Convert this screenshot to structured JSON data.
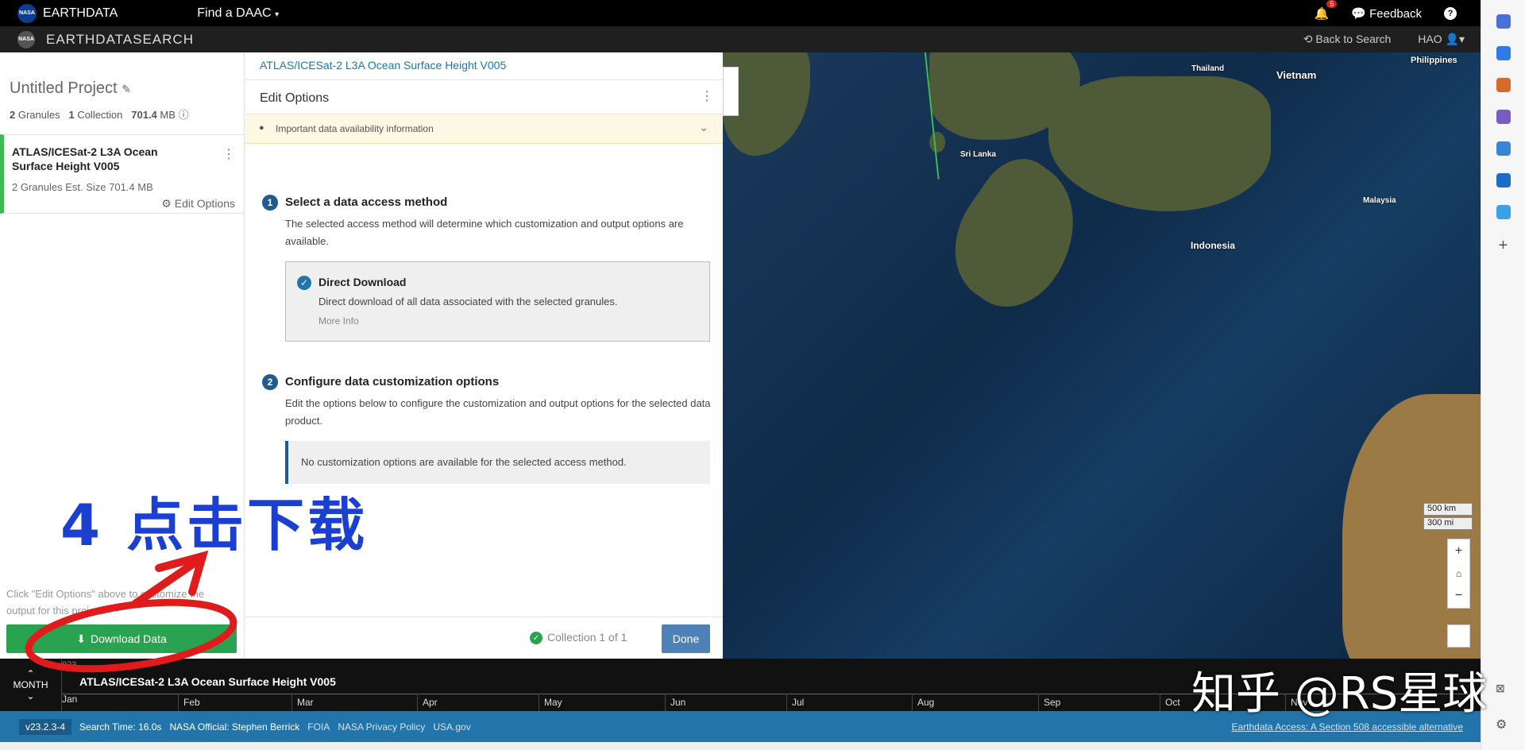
{
  "top_bar": {
    "brand": "EARTHDATA",
    "find_daac": "Find a DAAC",
    "notif_count": "5",
    "feedback": "Feedback",
    "help": "?"
  },
  "second_bar": {
    "title": "EARTHDATASEARCH",
    "back_to_search": "Back to Search",
    "user": "HAO"
  },
  "project": {
    "title": "Untitled Project",
    "granules_count": "2",
    "granules_label": "Granules",
    "collection_count": "1",
    "collection_label": "Collection",
    "size": "701.4",
    "size_unit": "MB"
  },
  "collection_card": {
    "name": "ATLAS/ICESat-2 L3A Ocean Surface Height V005",
    "meta": "2 Granules   Est. Size 701.4 MB",
    "edit": "Edit Options"
  },
  "left_note": "Click \"Edit Options\" above to customize the output for this project.",
  "download_button": "Download Data",
  "center": {
    "breadcrumb": "ATLAS/ICESat-2 L3A Ocean Surface Height V005",
    "heading": "Edit Options",
    "notice": "Important data availability information",
    "step1": {
      "num": "1",
      "title": "Select a data access method",
      "desc": "The selected access method will determine which customization and output options are available."
    },
    "method": {
      "title": "Direct Download",
      "desc": "Direct download of all data associated with the selected granules.",
      "more": "More Info"
    },
    "step2": {
      "num": "2",
      "title": "Configure data customization options",
      "desc": "Edit the options below to configure the customization and output options for the selected data product."
    },
    "no_custom": "No customization options are available for the selected access method.",
    "footer_count": "Collection 1 of 1",
    "done": "Done"
  },
  "map": {
    "labels": [
      "Philippines",
      "Thailand",
      "Vietnam",
      "Sri Lanka",
      "Malaysia",
      "Indonesia"
    ],
    "scale_km": "500 km",
    "scale_mi": "300 mi",
    "zoom_in": "+",
    "home": "⌂",
    "zoom_out": "−"
  },
  "timeline": {
    "interval": "MONTH",
    "collection": "ATLAS/ICESat-2 L3A Ocean Surface Height V005",
    "year": "023",
    "months": [
      "Jan",
      "Feb",
      "Mar",
      "Apr",
      "May",
      "Jun",
      "Jul",
      "Aug",
      "Sep",
      "Oct",
      "Nov"
    ]
  },
  "footer": {
    "version": "v23.2.3-4",
    "search_time": "Search Time: 16.0s",
    "official": "NASA Official: Stephen Berrick",
    "foia": "FOIA",
    "privacy": "NASA Privacy Policy",
    "usagov": "USA.gov",
    "access": "Earthdata Access: A Section 508 accessible alternative"
  },
  "annotation": "4 点击下载",
  "watermark": "知乎 @RS星球",
  "colors": {
    "accent": "#2275aa",
    "download": "#2aa351",
    "done": "#4e82b6",
    "annotation": "#1b3fd1"
  }
}
